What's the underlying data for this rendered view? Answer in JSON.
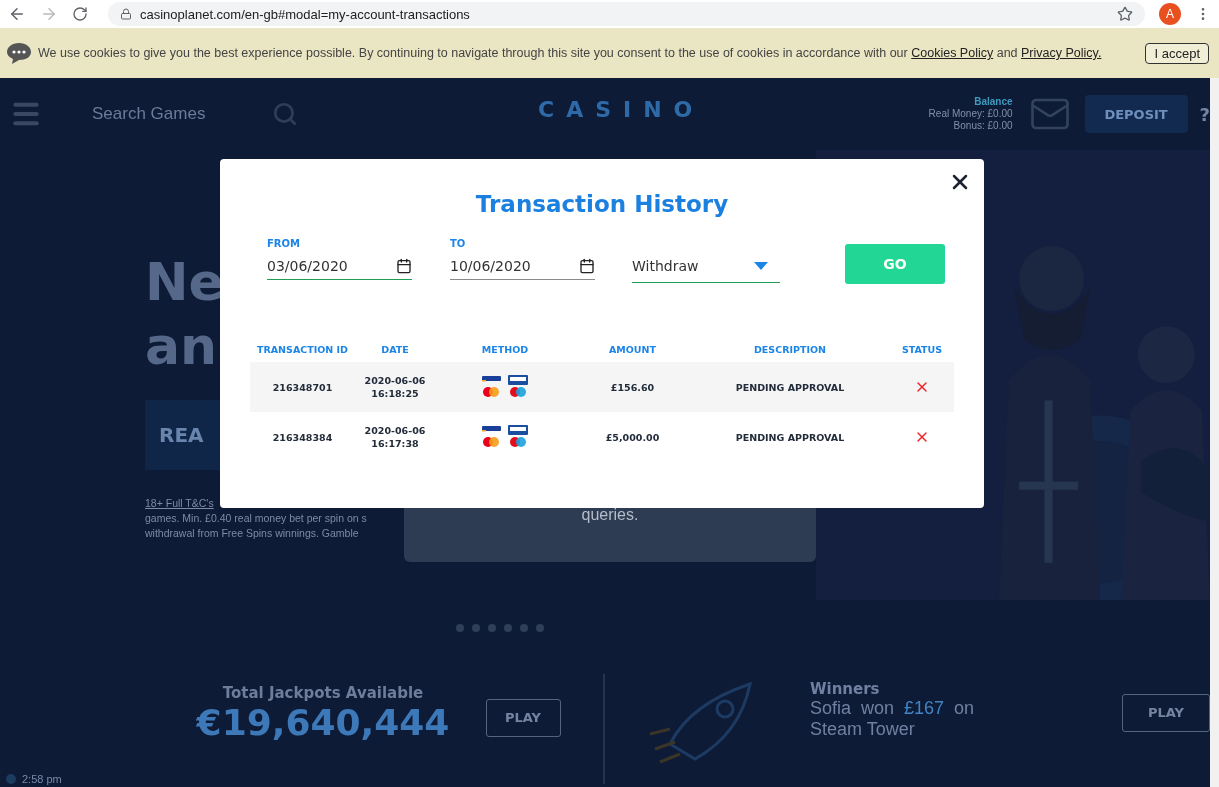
{
  "browser": {
    "url": "casinoplanet.com/en-gb#modal=my-account-transactions",
    "avatar": "A"
  },
  "cookie_bar": {
    "text_before": "We use cookies to give you the best experience possible. By continuing to navigate through this site you consent to the use of cookies in accordance with our ",
    "link_1": "Cookies Policy",
    "text_between": " and ",
    "link_2": "Privacy Policy.",
    "accept_button": "I accept"
  },
  "site_header": {
    "search_placeholder": "Search Games",
    "logo": "CASINO",
    "balance_label": "Balance",
    "real_money": "Real Money: £0.00",
    "bonus": "Bonus: £0.00",
    "deposit_button": "DEPOSIT",
    "help": "?"
  },
  "hero": {
    "heading_lines": [
      "Ne",
      "an"
    ],
    "button": "REA",
    "terms_link": "18+ Full T&C's",
    "terms_lines": [
      "games. Min. £0.40 real money bet per spin on s",
      "withdrawal from Free Spins winnings. Gamble"
    ],
    "card_text": "queries."
  },
  "carousel_dots": [
    {
      "selected": false
    },
    {
      "selected": false
    },
    {
      "selected": false
    },
    {
      "selected": false
    },
    {
      "selected": false
    },
    {
      "selected": false
    }
  ],
  "jackpot": {
    "label": "Total Jackpots Available",
    "amount": "€19,640,444",
    "play_button": "PLAY"
  },
  "winners": {
    "label": "Winners",
    "line_1_before": "Sofia  won  ",
    "amount": "£167",
    "line_1_after": "  on",
    "line_2": "Steam Tower",
    "play_button": "PLAY"
  },
  "clock": "2:58 pm",
  "modal": {
    "title": "Transaction History",
    "filters": [
      {
        "kind": "date",
        "label": "FROM",
        "value": "03/06/2020",
        "focused": true
      },
      {
        "kind": "date",
        "label": "TO",
        "value": "10/06/2020",
        "focused": false
      },
      {
        "kind": "select",
        "value": "Withdraw",
        "focused": true
      }
    ],
    "go_button": "GO",
    "table": {
      "columns": [
        "TRANSACTION ID",
        "DATE",
        "METHOD",
        "AMOUNT",
        "DESCRIPTION",
        "STATUS"
      ],
      "rows": [
        {
          "id": "216348701",
          "date": "2020-06-06",
          "time": "16:18:25",
          "amount": "£156.60",
          "description": "PENDING APPROVAL"
        },
        {
          "id": "216348384",
          "date": "2020-06-06",
          "time": "16:17:38",
          "amount": "£5,000.00",
          "description": "PENDING APPROVAL"
        }
      ]
    }
  }
}
